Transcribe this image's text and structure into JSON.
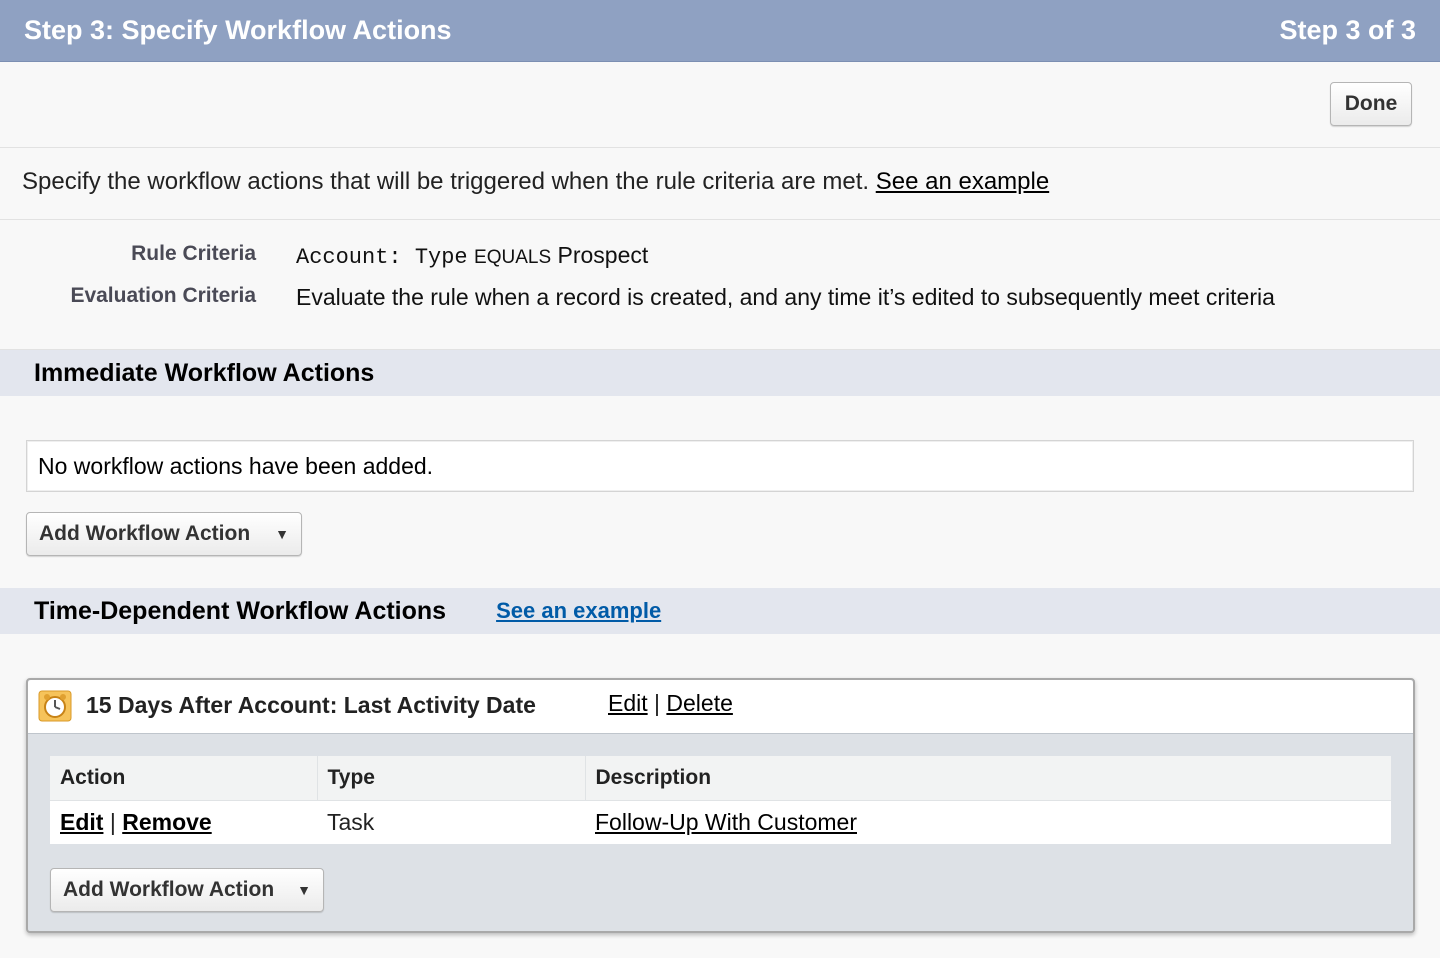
{
  "header": {
    "title": "Step 3: Specify Workflow Actions",
    "step": "Step 3 of 3"
  },
  "toolbar": {
    "done_label": "Done"
  },
  "intro": {
    "text": "Specify the workflow actions that will be triggered when the rule criteria are met. ",
    "link": "See an example"
  },
  "criteria": {
    "rule_label": "Rule Criteria",
    "rule_field": "Account: Type",
    "rule_operator": "EQUALS",
    "rule_value": "Prospect",
    "evaluation_label": "Evaluation Criteria",
    "evaluation_value": "Evaluate the rule when a record is created, and any time it’s edited to subsequently meet criteria"
  },
  "immediate": {
    "title": "Immediate Workflow Actions",
    "empty_message": "No workflow actions have been added.",
    "add_label": "Add Workflow Action"
  },
  "time_dependent": {
    "title": "Time-Dependent Workflow Actions",
    "example_link": "See an example",
    "trigger": {
      "title": "15 Days After Account: Last Activity Date",
      "edit_label": "Edit",
      "delete_label": "Delete"
    },
    "table": {
      "columns": [
        "Action",
        "Type",
        "Description"
      ],
      "rows": [
        {
          "edit": "Edit",
          "remove": "Remove",
          "type": "Task",
          "description": "Follow-Up With Customer"
        }
      ]
    },
    "add_label": "Add Workflow Action"
  },
  "icons": {
    "dropdown": "caret-down-icon",
    "trigger": "alarm-clock-icon"
  },
  "colors": {
    "title_bar": "#8fa1c2",
    "section_header": "#e3e6ee",
    "link_blue": "#015ba7"
  }
}
